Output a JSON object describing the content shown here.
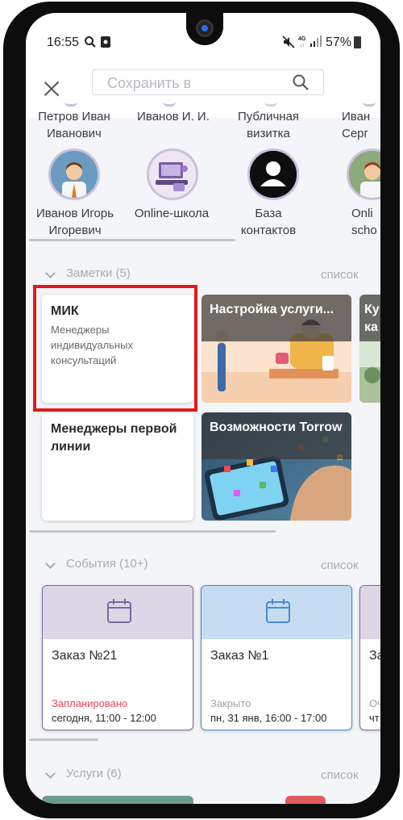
{
  "status_bar": {
    "time": "16:55",
    "battery": "57%"
  },
  "search": {
    "placeholder": "Сохранить в"
  },
  "contacts_row1": [
    {
      "name": "Петров Иван Иванович"
    },
    {
      "name": "Иванов И. И."
    },
    {
      "name": "Публичная визитка"
    },
    {
      "name": "Иван Серг"
    }
  ],
  "contacts_row2": [
    {
      "name": "Иванов Игорь Игоревич",
      "avatar": "person-avatar"
    },
    {
      "name": "Online-школа",
      "avatar": "school-avatar"
    },
    {
      "name": "База контактов",
      "avatar": "user-icon"
    },
    {
      "name": "Onli scho",
      "avatar": "person-avatar"
    }
  ],
  "notes": {
    "header": "Заметки (5)",
    "list_link": "список",
    "cards": [
      {
        "title": "МИК",
        "subtitle": "Менеджеры индивидуальных консультаций"
      },
      {
        "title": "Настройка услуги...",
        "image": "service-illustration"
      },
      {
        "title": "Ку ка",
        "image": "illustration"
      },
      {
        "title": "Менеджеры первой линии"
      },
      {
        "title": "Возможности Torrow",
        "image": "phone-photo"
      }
    ]
  },
  "events": {
    "header": "События (10+)",
    "list_link": "список",
    "cards": [
      {
        "title": "Заказ №21",
        "status": "Запланировано",
        "time": "сегодня, 11:00 - 12:00",
        "status_color": "#e8465a",
        "top_color": "#ddd6e6"
      },
      {
        "title": "Заказ №1",
        "status": "Закрыто",
        "time": "пн, 31 янв, 16:00 - 17:00",
        "status_color": "#a0a4aa",
        "top_color": "#c6dcf0"
      },
      {
        "title": "За",
        "status": "Оч",
        "time": "чт",
        "status_color": "#a0a4aa",
        "top_color": "#ddd6e6"
      }
    ]
  },
  "services": {
    "header": "Услуги (6)",
    "list_link": "список"
  },
  "colors": {
    "accent_purple": "#7b6a9c",
    "accent_blue": "#4a8ad0",
    "highlight": "#e01a1a"
  }
}
